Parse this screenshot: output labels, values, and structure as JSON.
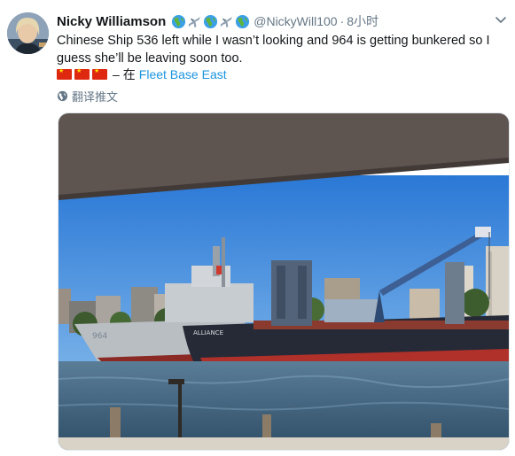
{
  "user": {
    "name": "Nicky Williamson",
    "handle": "@NickyWill100",
    "separator": "·",
    "time": "8小时",
    "name_emojis": [
      "earth-globe",
      "airplane",
      "earth-globe",
      "airplane",
      "earth-globe"
    ]
  },
  "tweet": {
    "text": "Chinese Ship 536 left while I wasn’t looking and 964 is getting bunkered so I guess she’ll be leaving soon too.",
    "flags": [
      "china-flag",
      "china-flag",
      "china-flag"
    ],
    "location_separator": "–",
    "location_prefix": "在",
    "location": "Fleet Base East"
  },
  "translate": {
    "label": "翻译推文",
    "icon": "globe-icon"
  },
  "photo": {
    "ship_name_label": "ALLIANCE",
    "ship_number_label": "964"
  },
  "colors": {
    "link": "#1b95e0",
    "secondary_text": "#657786"
  }
}
